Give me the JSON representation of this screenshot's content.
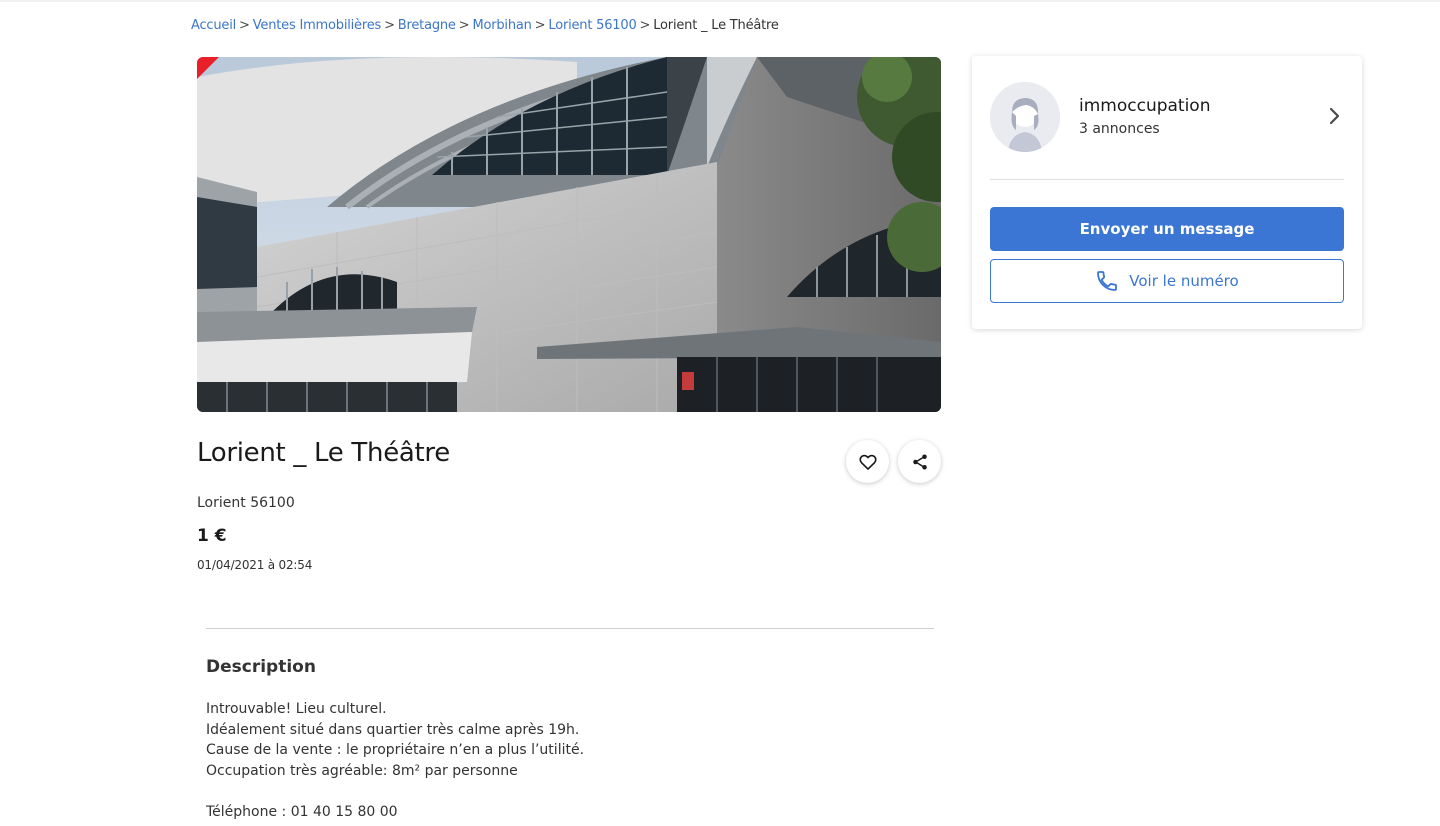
{
  "breadcrumb": {
    "items": [
      "Accueil",
      "Ventes Immobilières",
      "Bretagne",
      "Morbihan",
      "Lorient 56100"
    ],
    "current": "Lorient _ Le Théâtre",
    "separator": ">"
  },
  "listing": {
    "title": "Lorient _ Le Théâtre",
    "location": "Lorient 56100",
    "price": "1 €",
    "date": "01/04/2021 à 02:54",
    "photo_alt": "theater-building-photo"
  },
  "description": {
    "heading": "Description",
    "lines": [
      "Introuvable! Lieu culturel.",
      "Idéalement situé dans quartier très calme après 19h.",
      "Cause de la vente : le propriétaire n’en a plus l’utilité.",
      "Occupation très agréable: 8m² par personne"
    ],
    "phone_line": "Téléphone : 01 40 15 80 00"
  },
  "seller": {
    "name": "immoccupation",
    "ads_count": "3 annonces",
    "message_button": "Envoyer un message",
    "phone_button": "Voir le numéro"
  },
  "icons": {
    "favorite": "heart-icon",
    "share": "share-icon",
    "chevron": "chevron-right-icon",
    "phone": "phone-icon",
    "avatar": "user-avatar-icon"
  },
  "colors": {
    "accent": "#3b76d4",
    "link": "#3b76c9",
    "badge": "#e8202a"
  }
}
